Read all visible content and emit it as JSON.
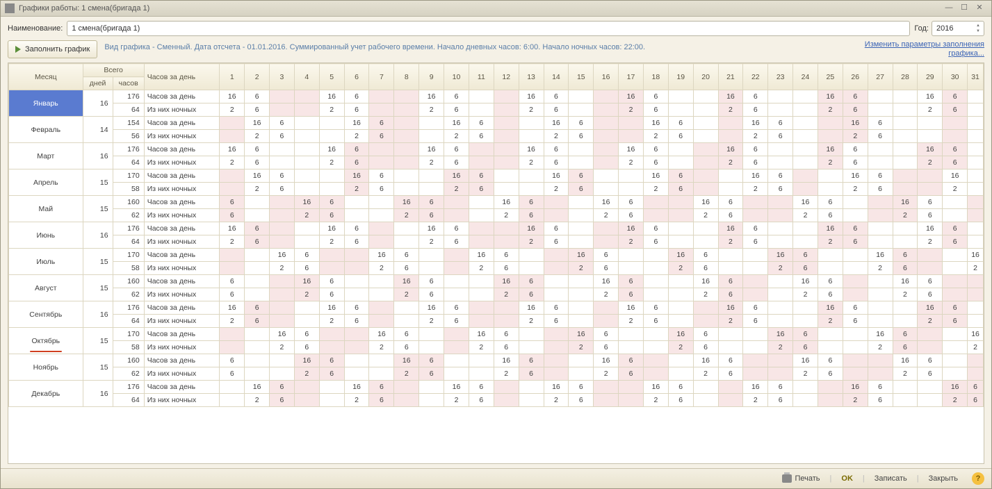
{
  "title": "Графики работы: 1 смена(бригада 1)",
  "labels": {
    "name": "Наименование:",
    "year": "Год:",
    "fill": "Заполнить график",
    "info": "Вид графика - Сменный. Дата отсчета - 01.01.2016. Суммированный учет рабочего времени. Начало дневных часов: 6:00. Начало ночных часов: 22:00.",
    "link1": "Изменить параметры заполнения",
    "link2": "графика...",
    "month": "Месяц",
    "total": "Всего",
    "perDay": "Часов за день",
    "days": "дней",
    "hours": "часов",
    "row1": "Часов за день",
    "row2": "Из них ночных"
  },
  "name_value": "1 смена(бригада 1)",
  "year_value": "2016",
  "footer": {
    "print": "Печать",
    "ok": "OK",
    "save": "Записать",
    "close": "Закрыть"
  },
  "pink_cols": {
    "0": [
      3,
      4,
      7,
      8,
      12,
      16,
      17,
      21,
      25,
      26,
      30
    ],
    "1": [
      1,
      7,
      8,
      12,
      16,
      17,
      21,
      25,
      26,
      30
    ],
    "2": [
      6,
      7,
      8,
      11,
      12,
      16,
      20,
      21,
      25,
      29,
      30
    ],
    "3": [
      1,
      6,
      10,
      11,
      15,
      19,
      20,
      24,
      28,
      29
    ],
    "4": [
      1,
      3,
      4,
      5,
      8,
      9,
      10,
      13,
      14,
      18,
      19,
      22,
      23,
      27,
      28,
      31
    ],
    "5": [
      2,
      3,
      7,
      11,
      12,
      13,
      16,
      17,
      21,
      25,
      26,
      30
    ],
    "6": [
      1,
      5,
      6,
      10,
      14,
      15,
      19,
      23,
      24,
      28,
      29
    ],
    "7": [
      3,
      4,
      8,
      12,
      13,
      17,
      21,
      22,
      26,
      30,
      31
    ],
    "8": [
      2,
      3,
      7,
      11,
      12,
      16,
      20,
      21,
      25,
      29,
      30
    ],
    "9": [
      1,
      5,
      6,
      10,
      14,
      15,
      19,
      23,
      24,
      28,
      29
    ],
    "10": [
      4,
      5,
      8,
      9,
      13,
      14,
      17,
      18,
      22,
      23,
      26,
      27,
      31
    ],
    "11": [
      3,
      4,
      7,
      8,
      12,
      16,
      17,
      21,
      25,
      26,
      30,
      31
    ]
  },
  "months": [
    {
      "name": "Январь",
      "days": 16,
      "hours": 176,
      "night": 64,
      "d": {
        "1": 16,
        "2": 6,
        "5": 16,
        "6": 6,
        "9": 16,
        "10": 6,
        "13": 16,
        "14": 6,
        "17": 16,
        "18": 6,
        "21": 16,
        "22": 6,
        "25": 16,
        "26": 6,
        "29": 16,
        "30": 6
      },
      "n": {
        "1": 2,
        "2": 6,
        "5": 2,
        "6": 6,
        "9": 2,
        "10": 6,
        "13": 2,
        "14": 6,
        "17": 2,
        "18": 6,
        "21": 2,
        "22": 6,
        "25": 2,
        "26": 6,
        "29": 2,
        "30": 6
      }
    },
    {
      "name": "Февраль",
      "days": 14,
      "hours": 154,
      "night": 56,
      "d": {
        "2": 16,
        "3": 6,
        "6": 16,
        "7": 6,
        "10": 16,
        "11": 6,
        "14": 16,
        "15": 6,
        "18": 16,
        "19": 6,
        "22": 16,
        "23": 6,
        "26": 16,
        "27": 6
      },
      "n": {
        "2": 2,
        "3": 6,
        "6": 2,
        "7": 6,
        "10": 2,
        "11": 6,
        "14": 2,
        "15": 6,
        "18": 2,
        "19": 6,
        "22": 2,
        "23": 6,
        "26": 2,
        "27": 6
      }
    },
    {
      "name": "Март",
      "days": 16,
      "hours": 176,
      "night": 64,
      "d": {
        "1": 16,
        "2": 6,
        "5": 16,
        "6": 6,
        "9": 16,
        "10": 6,
        "13": 16,
        "14": 6,
        "17": 16,
        "18": 6,
        "21": 16,
        "22": 6,
        "25": 16,
        "26": 6,
        "29": 16,
        "30": 6
      },
      "n": {
        "1": 2,
        "2": 6,
        "5": 2,
        "6": 6,
        "9": 2,
        "10": 6,
        "13": 2,
        "14": 6,
        "17": 2,
        "18": 6,
        "21": 2,
        "22": 6,
        "25": 2,
        "26": 6,
        "29": 2,
        "30": 6
      }
    },
    {
      "name": "Апрель",
      "days": 15,
      "hours": 170,
      "night": 58,
      "d": {
        "2": 16,
        "3": 6,
        "6": 16,
        "7": 6,
        "10": 16,
        "11": 6,
        "14": 16,
        "15": 6,
        "18": 16,
        "19": 6,
        "22": 16,
        "23": 6,
        "26": 16,
        "27": 6,
        "30": 16
      },
      "n": {
        "2": 2,
        "3": 6,
        "6": 2,
        "7": 6,
        "10": 2,
        "11": 6,
        "14": 2,
        "15": 6,
        "18": 2,
        "19": 6,
        "22": 2,
        "23": 6,
        "26": 2,
        "27": 6,
        "30": 2
      }
    },
    {
      "name": "Май",
      "days": 15,
      "hours": 160,
      "night": 62,
      "d": {
        "1": 6,
        "4": 16,
        "5": 6,
        "8": 16,
        "9": 6,
        "12": 16,
        "13": 6,
        "16": 16,
        "17": 6,
        "20": 16,
        "21": 6,
        "24": 16,
        "25": 6,
        "28": 16,
        "29": 6
      },
      "n": {
        "1": 6,
        "4": 2,
        "5": 6,
        "8": 2,
        "9": 6,
        "12": 2,
        "13": 6,
        "16": 2,
        "17": 6,
        "20": 2,
        "21": 6,
        "24": 2,
        "25": 6,
        "28": 2,
        "29": 6
      }
    },
    {
      "name": "Июнь",
      "days": 16,
      "hours": 176,
      "night": 64,
      "d": {
        "1": 16,
        "2": 6,
        "5": 16,
        "6": 6,
        "9": 16,
        "10": 6,
        "13": 16,
        "14": 6,
        "17": 16,
        "18": 6,
        "21": 16,
        "22": 6,
        "25": 16,
        "26": 6,
        "29": 16,
        "30": 6
      },
      "n": {
        "1": 2,
        "2": 6,
        "5": 2,
        "6": 6,
        "9": 2,
        "10": 6,
        "13": 2,
        "14": 6,
        "17": 2,
        "18": 6,
        "21": 2,
        "22": 6,
        "25": 2,
        "26": 6,
        "29": 2,
        "30": 6
      }
    },
    {
      "name": "Июль",
      "days": 15,
      "hours": 170,
      "night": 58,
      "d": {
        "3": 16,
        "4": 6,
        "7": 16,
        "8": 6,
        "11": 16,
        "12": 6,
        "15": 16,
        "16": 6,
        "19": 16,
        "20": 6,
        "23": 16,
        "24": 6,
        "27": 16,
        "28": 6,
        "31": 16
      },
      "n": {
        "3": 2,
        "4": 6,
        "7": 2,
        "8": 6,
        "11": 2,
        "12": 6,
        "15": 2,
        "16": 6,
        "19": 2,
        "20": 6,
        "23": 2,
        "24": 6,
        "27": 2,
        "28": 6,
        "31": 2
      }
    },
    {
      "name": "Август",
      "days": 15,
      "hours": 160,
      "night": 62,
      "d": {
        "1": 6,
        "4": 16,
        "5": 6,
        "8": 16,
        "9": 6,
        "12": 16,
        "13": 6,
        "16": 16,
        "17": 6,
        "20": 16,
        "21": 6,
        "24": 16,
        "25": 6,
        "28": 16,
        "29": 6
      },
      "n": {
        "1": 6,
        "4": 2,
        "5": 6,
        "8": 2,
        "9": 6,
        "12": 2,
        "13": 6,
        "16": 2,
        "17": 6,
        "20": 2,
        "21": 6,
        "24": 2,
        "25": 6,
        "28": 2,
        "29": 6
      }
    },
    {
      "name": "Сентябрь",
      "days": 16,
      "hours": 176,
      "night": 64,
      "d": {
        "1": 16,
        "2": 6,
        "5": 16,
        "6": 6,
        "9": 16,
        "10": 6,
        "13": 16,
        "14": 6,
        "17": 16,
        "18": 6,
        "21": 16,
        "22": 6,
        "25": 16,
        "26": 6,
        "29": 16,
        "30": 6
      },
      "n": {
        "1": 2,
        "2": 6,
        "5": 2,
        "6": 6,
        "9": 2,
        "10": 6,
        "13": 2,
        "14": 6,
        "17": 2,
        "18": 6,
        "21": 2,
        "22": 6,
        "25": 2,
        "26": 6,
        "29": 2,
        "30": 6
      }
    },
    {
      "name": "Октябрь",
      "days": 15,
      "hours": 170,
      "night": 58,
      "d": {
        "3": 16,
        "4": 6,
        "7": 16,
        "8": 6,
        "11": 16,
        "12": 6,
        "15": 16,
        "16": 6,
        "19": 16,
        "20": 6,
        "23": 16,
        "24": 6,
        "27": 16,
        "28": 6,
        "31": 16
      },
      "n": {
        "3": 2,
        "4": 6,
        "7": 2,
        "8": 6,
        "11": 2,
        "12": 6,
        "15": 2,
        "16": 6,
        "19": 2,
        "20": 6,
        "23": 2,
        "24": 6,
        "27": 2,
        "28": 6,
        "31": 2
      }
    },
    {
      "name": "Ноябрь",
      "days": 15,
      "hours": 160,
      "night": 62,
      "d": {
        "1": 6,
        "4": 16,
        "5": 6,
        "8": 16,
        "9": 6,
        "12": 16,
        "13": 6,
        "16": 16,
        "17": 6,
        "20": 16,
        "21": 6,
        "24": 16,
        "25": 6,
        "28": 16,
        "29": 6
      },
      "n": {
        "1": 6,
        "4": 2,
        "5": 6,
        "8": 2,
        "9": 6,
        "12": 2,
        "13": 6,
        "16": 2,
        "17": 6,
        "20": 2,
        "21": 6,
        "24": 2,
        "25": 6,
        "28": 2,
        "29": 6
      }
    },
    {
      "name": "Декабрь",
      "days": 16,
      "hours": 176,
      "night": 64,
      "d": {
        "2": 16,
        "3": 6,
        "6": 16,
        "7": 6,
        "10": 16,
        "11": 6,
        "14": 16,
        "15": 6,
        "18": 16,
        "19": 6,
        "22": 16,
        "23": 6,
        "26": 16,
        "27": 6,
        "30": 16,
        "31": 6
      },
      "n": {
        "2": 2,
        "3": 6,
        "6": 2,
        "7": 6,
        "10": 2,
        "11": 6,
        "14": 2,
        "15": 6,
        "18": 2,
        "19": 6,
        "22": 2,
        "23": 6,
        "26": 2,
        "27": 6,
        "30": 2,
        "31": 6
      }
    }
  ]
}
